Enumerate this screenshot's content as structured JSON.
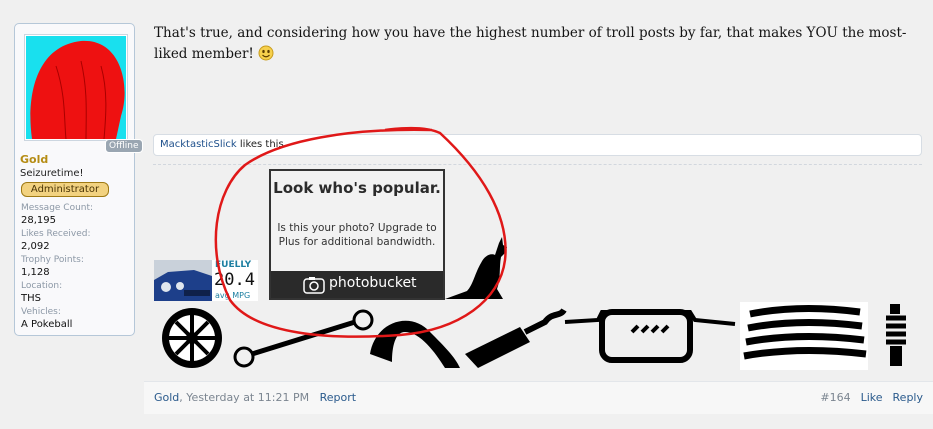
{
  "user": {
    "status": "Offline",
    "name": "Gold",
    "title": "Seizuretime!",
    "role": "Administrator",
    "stats": [
      {
        "label": "Message Count:",
        "value": "28,195"
      },
      {
        "label": "Likes Received:",
        "value": "2,092"
      },
      {
        "label": "Trophy Points:",
        "value": "1,128"
      },
      {
        "label": "Location:",
        "value": "THS"
      },
      {
        "label": "Vehicles:",
        "value": "A Pokeball"
      }
    ]
  },
  "message": {
    "text": "That's true, and considering how you have the highest number of troll posts by far, that makes YOU the most-liked member!",
    "likes_user": "MacktasticSlick",
    "likes_suffix": " likes this."
  },
  "signature": {
    "fuelly": {
      "label": "FUELLY",
      "value": "20.4",
      "unit": "avg MPG"
    },
    "photobucket": {
      "title": "Look who's popular.",
      "body": "Is this your photo? Upgrade to Plus for additional bandwidth.",
      "brand": "photobucket"
    }
  },
  "footer": {
    "author": "Gold",
    "time": "Yesterday at 11:21 PM",
    "report": "Report",
    "post_number": "#164",
    "like": "Like",
    "reply": "Reply"
  },
  "colors": {
    "username": "#b58c14",
    "link": "#2a5a8c",
    "annotation": "#e01818"
  }
}
